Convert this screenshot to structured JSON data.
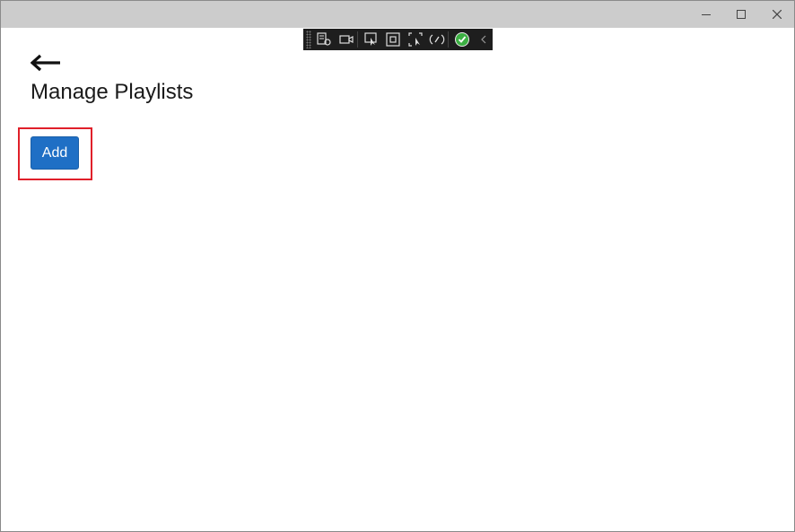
{
  "window": {
    "caption_buttons": [
      "minimize",
      "maximize",
      "close"
    ]
  },
  "debug_toolbar": {
    "icons": [
      "live-visual-tree-icon",
      "record-icon",
      "select-element-icon",
      "display-layout-adorners-icon",
      "track-focus-icon",
      "hot-reload-icon",
      "binding-ok-icon",
      "collapse-chevron-icon"
    ],
    "accent_color": "#3cb043"
  },
  "page": {
    "title": "Manage Playlists",
    "add_label": "Add"
  },
  "colors": {
    "titlebar": "#cccccc",
    "button_bg": "#1f6fc5",
    "highlight_border": "#e0202a"
  }
}
